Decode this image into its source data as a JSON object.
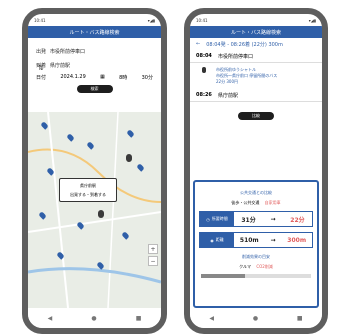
{
  "left": {
    "status": {
      "time": "10:41",
      "icons": "▾◢▮"
    },
    "title": "ルート・バス路線検索",
    "origin": {
      "tag": "出発",
      "value": "市役所前停車口"
    },
    "dest": {
      "tag": "到着",
      "value": "県庁前駅"
    },
    "date": {
      "label": "日付",
      "value": "2024.1.29",
      "hour": "8時",
      "minute": "30分"
    },
    "search_label": "検索",
    "popup": {
      "title": "県庁前駅",
      "actions": "出発する・到着する"
    },
    "nav": [
      "◀",
      "●",
      "■"
    ]
  },
  "right": {
    "status": {
      "time": "10:41",
      "icons": "▾◢▮"
    },
    "title": "ルート・バス路線検索",
    "route_summary": "08:04発 - 08:26着 (22分) 300m",
    "stops": [
      {
        "time": "08:04",
        "name": "市役所前停車口"
      },
      {
        "time": "08:26",
        "name": "県庁前駅"
      }
    ],
    "stop_info": "市役所前ゆうシャトル\n市役所〜県庁前口 停留所間のバス\n22分 300円",
    "search_label": "比較",
    "panel": {
      "title": "公共交通との比較",
      "sub_a": "徒歩・公共交通",
      "sub_b": "自家用車",
      "metrics": [
        {
          "label": "所要時間",
          "before": "31分",
          "after": "22分"
        },
        {
          "label": "距離",
          "before": "510m",
          "after": "300m"
        }
      ],
      "footer": "削減効果の目安",
      "mode": "クルマ",
      "extra": "CO2削減"
    },
    "nav": [
      "◀",
      "●",
      "■"
    ]
  },
  "colors": {
    "primary": "#2f5fa8",
    "accent": "#e05a5a"
  }
}
